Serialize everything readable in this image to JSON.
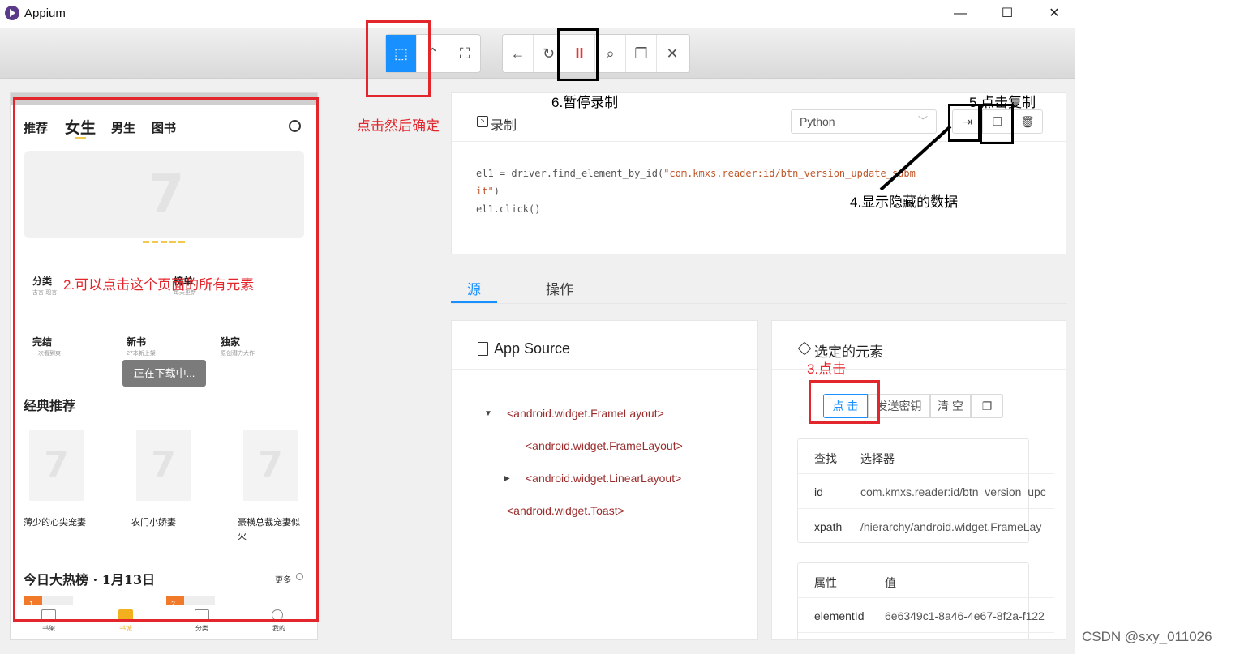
{
  "window": {
    "title": "Appium",
    "minimize": "—",
    "maximize": "☐",
    "close": "✕"
  },
  "toolbar": {
    "select_icon": "⬚",
    "swipe_icon": "⌃",
    "tap_coord_icon": "⛶",
    "back_icon": "←",
    "refresh_icon": "↻",
    "pause_icon": "II",
    "search_icon": "⌕",
    "copy_icon": "❐",
    "quit_icon": "✕"
  },
  "phone": {
    "tabs": [
      "推荐",
      "女生",
      "男生",
      "图书"
    ],
    "banner_logo": "7",
    "categories": [
      {
        "name": "分类",
        "sub": "古言·现言"
      },
      {
        "name": "榜单",
        "sub": "每天更新"
      },
      {
        "name": "完结",
        "sub": "一次看到爽"
      },
      {
        "name": "新书",
        "sub": "27本新上架"
      },
      {
        "name": "独家",
        "sub": "原创潜力大作"
      }
    ],
    "toast": "正在下载中...",
    "section_classic": "经典推荐",
    "books": [
      "薄少的心尖宠妻",
      "农门小娇妻",
      "豪横总裁宠妻似火"
    ],
    "section_hot": "今日大热榜 · 1月13日",
    "more": "更多",
    "rank_badges": [
      "1",
      "2"
    ],
    "nav": [
      "书架",
      "书城",
      "分类",
      "我的"
    ]
  },
  "recorder": {
    "title": "录制",
    "language": "Python",
    "code_line1_a": "el1 = driver.find_element_by_id(",
    "code_line1_b": "\"com.kmxs.reader:id/btn_version_update_subm",
    "code_line2": "it\"",
    "code_line2_c": ")",
    "code_line3": "el1.click()",
    "btn_show_hidden": "⇥",
    "btn_copy": "❐",
    "btn_clear": "🗑"
  },
  "tabs": {
    "source": "源",
    "actions": "操作"
  },
  "source_panel": {
    "title": "App Source",
    "nodes": [
      "<android.widget.FrameLayout>",
      "<android.widget.FrameLayout>",
      "<android.widget.LinearLayout>",
      "<android.widget.Toast>"
    ]
  },
  "selected_panel": {
    "title": "选定的元素",
    "buttons": [
      "点 击",
      "发送密钥",
      "清 空",
      "❐"
    ],
    "find_table": {
      "headers": [
        "查找",
        "选择器"
      ],
      "rows": [
        [
          "id",
          "com.kmxs.reader:id/btn_version_upc"
        ],
        [
          "xpath",
          "/hierarchy/android.widget.FrameLay"
        ]
      ]
    },
    "attr_table": {
      "headers": [
        "属性",
        "值"
      ],
      "rows": [
        [
          "elementId",
          "6e6349c1-8a46-4e67-8f2a-f122"
        ]
      ]
    }
  },
  "annotations": {
    "confirm": "点击然后确定",
    "pause": "6.暂停录制",
    "copy": "5.点击复制",
    "hidden": "4.显示隐藏的数据",
    "click_all": "2.可以点击这个页面的所有元素",
    "tap": "3.点击"
  },
  "watermark": "CSDN @sxy_011026",
  "colors": {
    "accent": "#1890ff",
    "annotation_red": "#e3262c",
    "string_code": "#c0572a",
    "xml_tag": "#9b2c2c"
  }
}
